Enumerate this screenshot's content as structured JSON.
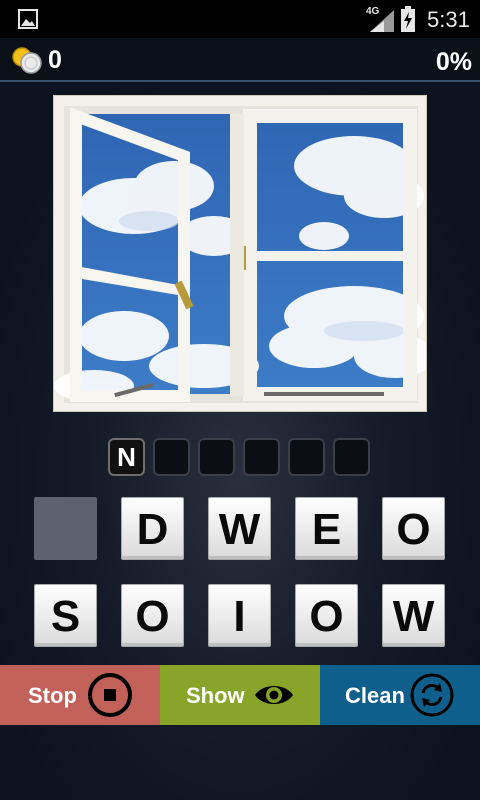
{
  "status_bar": {
    "network": "4G",
    "time": "5:31"
  },
  "header": {
    "coins": "0",
    "progress": "0%"
  },
  "picture": {
    "subject": "open window with blue cloudy sky"
  },
  "answer": {
    "slots": [
      "N",
      "",
      "",
      "",
      "",
      ""
    ]
  },
  "letters": {
    "row1": [
      "",
      "D",
      "W",
      "E",
      "O"
    ],
    "row2": [
      "S",
      "O",
      "I",
      "O",
      "W"
    ]
  },
  "buttons": {
    "stop": {
      "label": "Stop",
      "icon": "stop-icon",
      "color": "#c2605a"
    },
    "show": {
      "label": "Show",
      "icon": "eye-icon",
      "color": "#88a52a"
    },
    "clean": {
      "label": "Clean",
      "icon": "refresh-icon",
      "color": "#0f5f8c"
    }
  }
}
